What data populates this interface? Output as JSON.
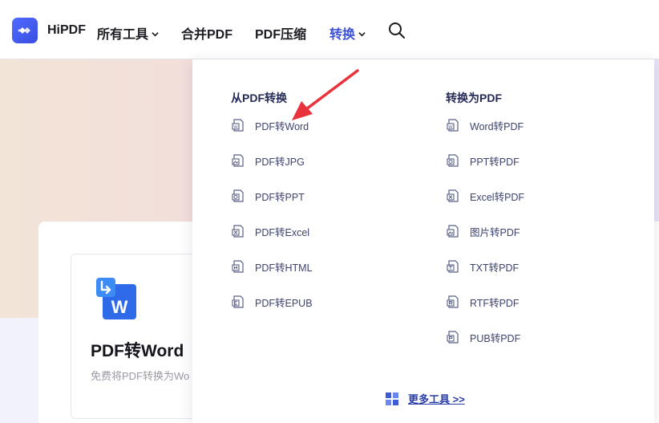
{
  "header": {
    "logo_text": "HiPDF",
    "nav": {
      "all_tools": "所有工具",
      "merge": "合并PDF",
      "compress": "PDF压缩",
      "convert": "转换"
    }
  },
  "dropdown": {
    "from_pdf": {
      "title": "从PDF转换",
      "items": [
        "PDF转Word",
        "PDF转JPG",
        "PDF转PPT",
        "PDF转Excel",
        "PDF转HTML",
        "PDF转EPUB"
      ]
    },
    "to_pdf": {
      "title": "转换为PDF",
      "items": [
        "Word转PDF",
        "PPT转PDF",
        "Excel转PDF",
        "图片转PDF",
        "TXT转PDF",
        "RTF转PDF",
        "PUB转PDF"
      ]
    },
    "more_tools": "更多工具 >>"
  },
  "tool_card": {
    "title": "PDF转Word",
    "description": "免费将PDF转换为Wo"
  },
  "colors": {
    "brand": "#3c53d6",
    "arrow": "#e8323c"
  }
}
